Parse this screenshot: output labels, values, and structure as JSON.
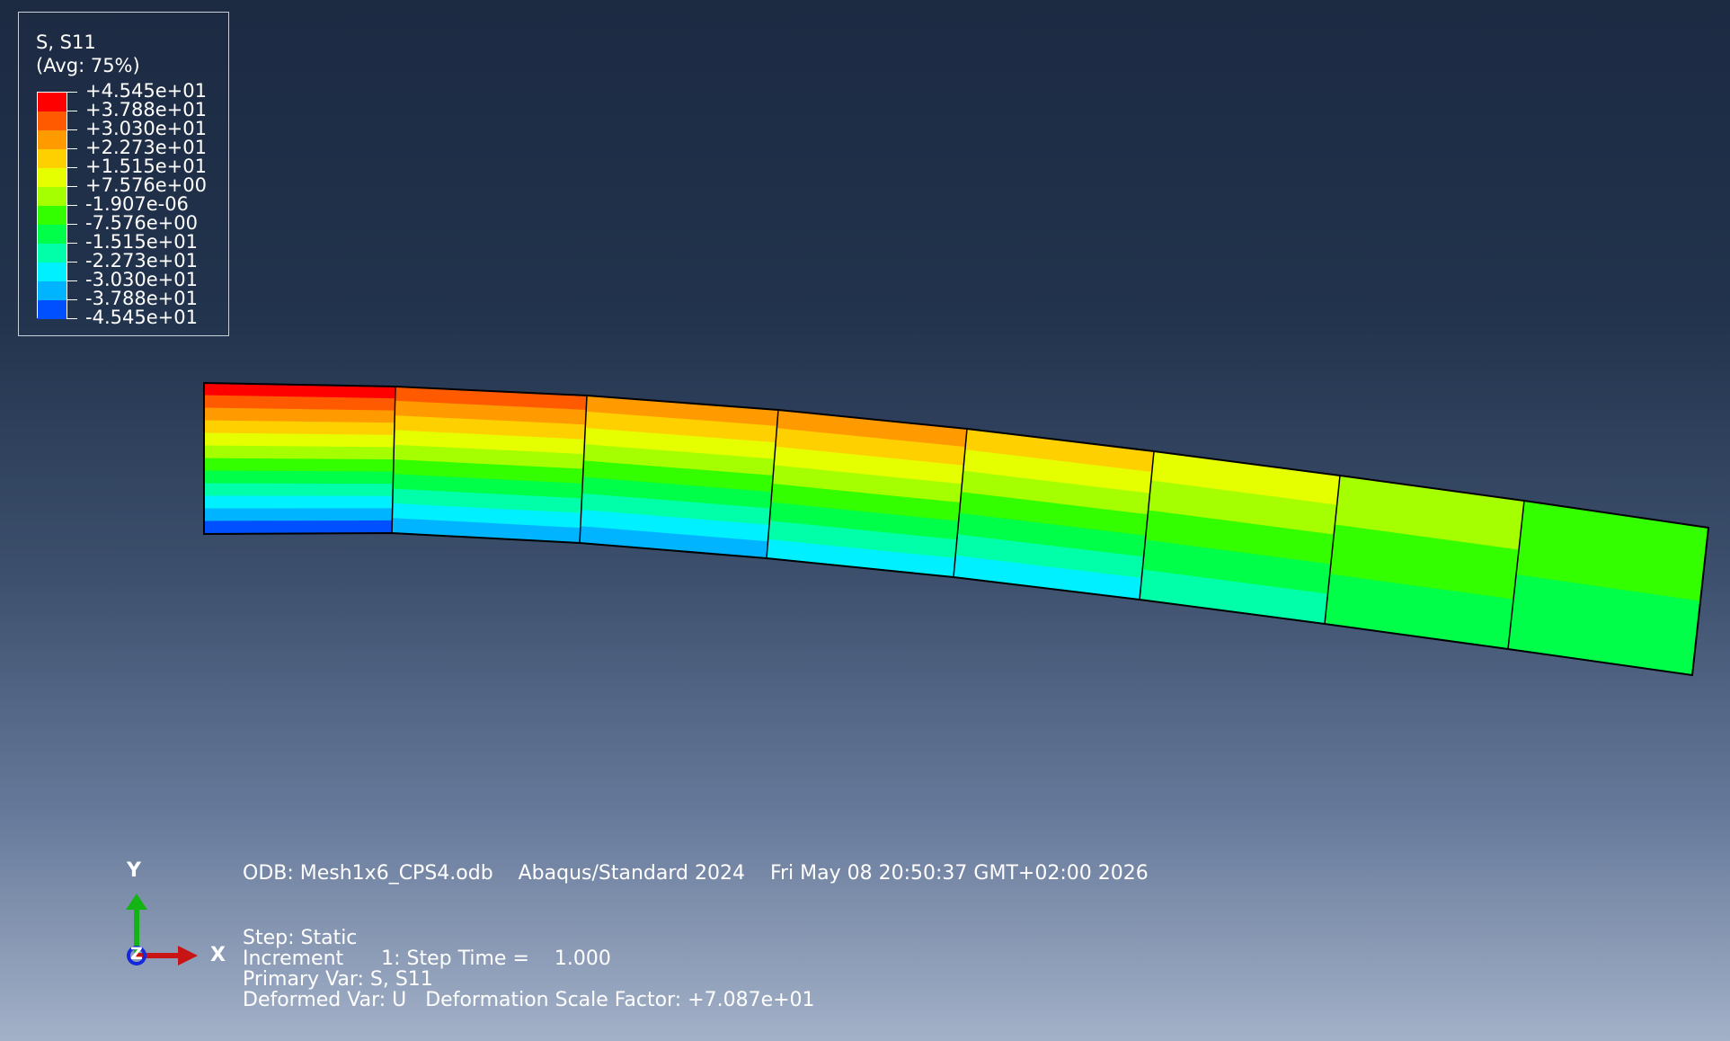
{
  "legend": {
    "title": "S, S11",
    "subtitle": "(Avg: 75%)",
    "levels": [
      {
        "label": "+4.545e+01",
        "color": "#ff0000"
      },
      {
        "label": "+3.788e+01",
        "color": "#ff5a00"
      },
      {
        "label": "+3.030e+01",
        "color": "#ff9a00"
      },
      {
        "label": "+2.273e+01",
        "color": "#ffd000"
      },
      {
        "label": "+1.515e+01",
        "color": "#e6ff00"
      },
      {
        "label": "+7.576e+00",
        "color": "#a6ff00"
      },
      {
        "label": "-1.907e-06",
        "color": "#34ff00"
      },
      {
        "label": "-7.576e+00",
        "color": "#00ff48"
      },
      {
        "label": "-1.515e+01",
        "color": "#00ffa8"
      },
      {
        "label": "-2.273e+01",
        "color": "#00f0ff"
      },
      {
        "label": "-3.030e+01",
        "color": "#00b4ff"
      },
      {
        "label": "-3.788e+01",
        "color": "#0050ff"
      },
      {
        "label": "-4.545e+01",
        "color": "#0000ff"
      }
    ]
  },
  "viewport": {
    "model": "Mesh1x6_CPS4",
    "mesh": {
      "rows": 1,
      "columns": 8
    }
  },
  "triad": {
    "x_label": "X",
    "y_label": "Y",
    "z_label": "Z",
    "x_color": "#c81414",
    "y_color": "#14b414",
    "z_color": "#1428dc"
  },
  "info": {
    "odb": "ODB: Mesh1x6_CPS4.odb    Abaqus/Standard 2024    Fri May 08 20:50:37 GMT+02:00 2026",
    "step": "Step: Static",
    "increment": "Increment      1: Step Time =    1.000",
    "primary_var": "Primary Var: S, S11",
    "deformed_var": "Deformed Var: U   Deformation Scale Factor: +7.087e+01"
  }
}
